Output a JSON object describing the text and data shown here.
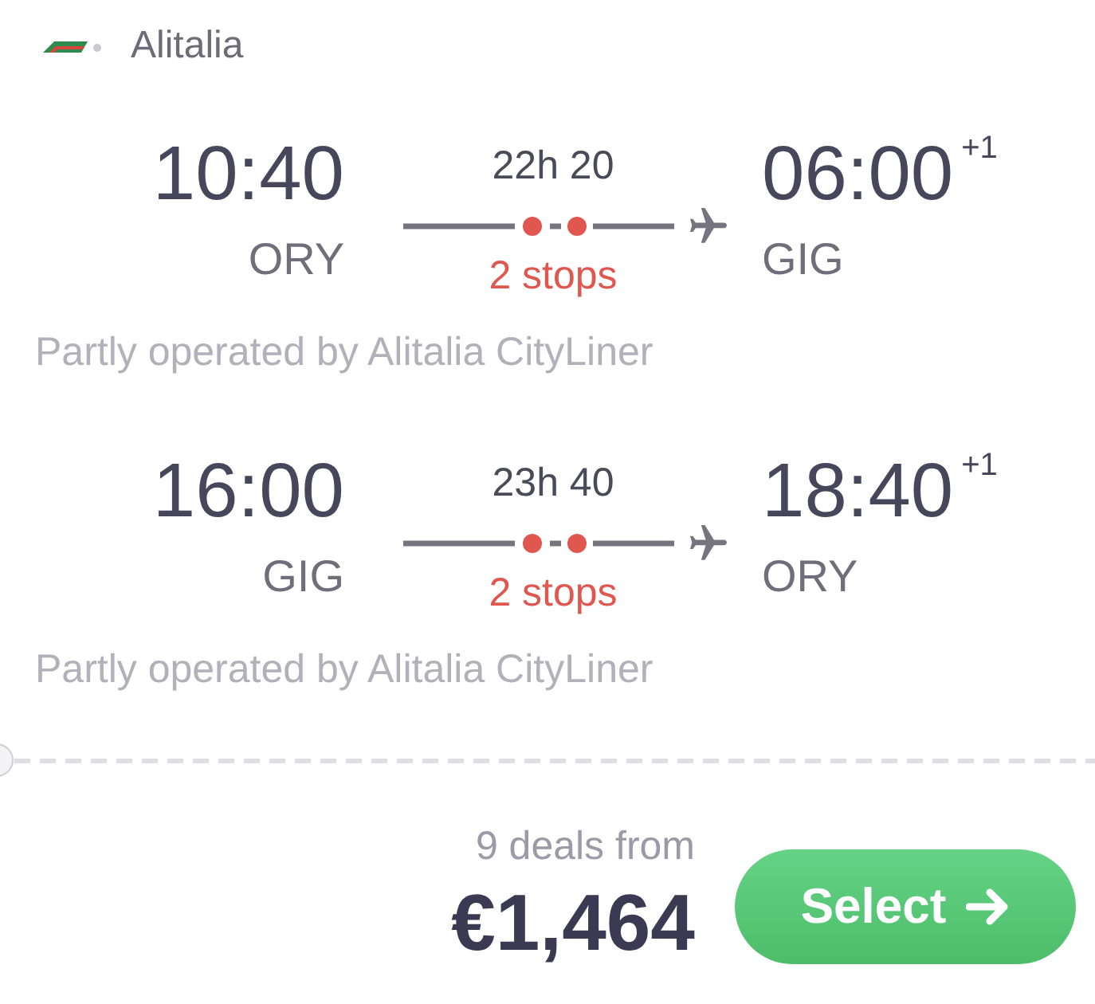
{
  "airline": {
    "name": "Alitalia"
  },
  "legs": [
    {
      "departure": {
        "time": "10:40",
        "airport": "ORY"
      },
      "duration": "22h 20",
      "stops": "2 stops",
      "arrival": {
        "time": "06:00",
        "day_offset": "+1",
        "airport": "GIG"
      },
      "operator_note": "Partly operated by Alitalia CityLiner"
    },
    {
      "departure": {
        "time": "16:00",
        "airport": "GIG"
      },
      "duration": "23h 40",
      "stops": "2 stops",
      "arrival": {
        "time": "18:40",
        "day_offset": "+1",
        "airport": "ORY"
      },
      "operator_note": "Partly operated by Alitalia CityLiner"
    }
  ],
  "price": {
    "deals": "9 deals from",
    "amount": "€1,464"
  },
  "select_button": {
    "label": "Select"
  }
}
